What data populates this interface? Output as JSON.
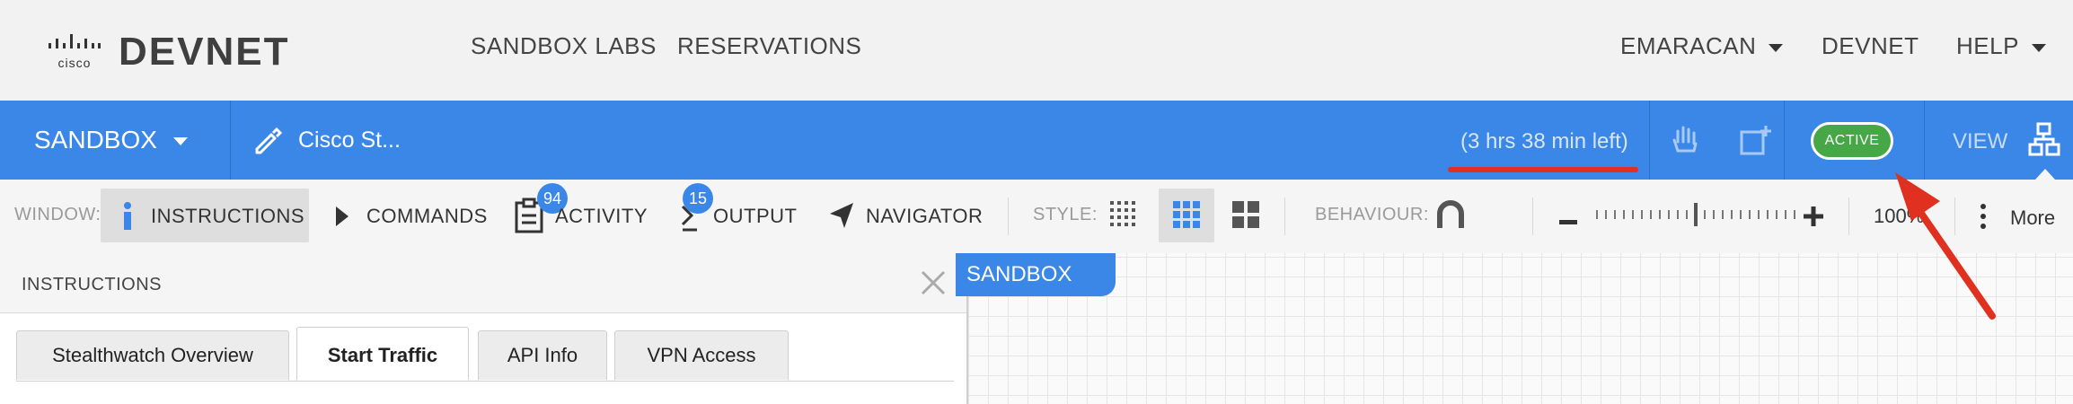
{
  "header": {
    "logo_small": "cisco",
    "logo_text": "DEVNET",
    "nav": [
      "SANDBOX LABS",
      "RESERVATIONS"
    ],
    "user": "EMARACAN",
    "devnet_link": "DEVNET",
    "help": "HELP"
  },
  "sandbox_bar": {
    "menu_label": "SANDBOX",
    "lab_name": "Cisco St...",
    "time_left": "(3 hrs 38 min left)",
    "status": "ACTIVE",
    "view_label": "VIEW",
    "icons": [
      "hand-icon",
      "add-page-icon",
      "network-topology-icon"
    ],
    "accent_color": "#3a87e8",
    "status_color": "#46a747",
    "annotation_color": "#e03020"
  },
  "toolbar": {
    "window_label": "WINDOW:",
    "instructions": "INSTRUCTIONS",
    "commands": "COMMANDS",
    "activity": "ACTIVITY",
    "activity_badge": "94",
    "output": "OUTPUT",
    "output_badge": "15",
    "navigator": "NAVIGATOR",
    "style_label": "STYLE:",
    "behaviour_label": "BEHAVIOUR:",
    "zoom": "100%",
    "more": "More",
    "zoom_level": 0.5
  },
  "instructions_panel": {
    "title": "INSTRUCTIONS",
    "tabs": [
      {
        "label": "Stealthwatch Overview",
        "active": false
      },
      {
        "label": "Start Traffic",
        "active": true
      },
      {
        "label": "API Info",
        "active": false
      },
      {
        "label": "VPN Access",
        "active": false
      }
    ]
  },
  "canvas": {
    "tag": "SANDBOX"
  }
}
